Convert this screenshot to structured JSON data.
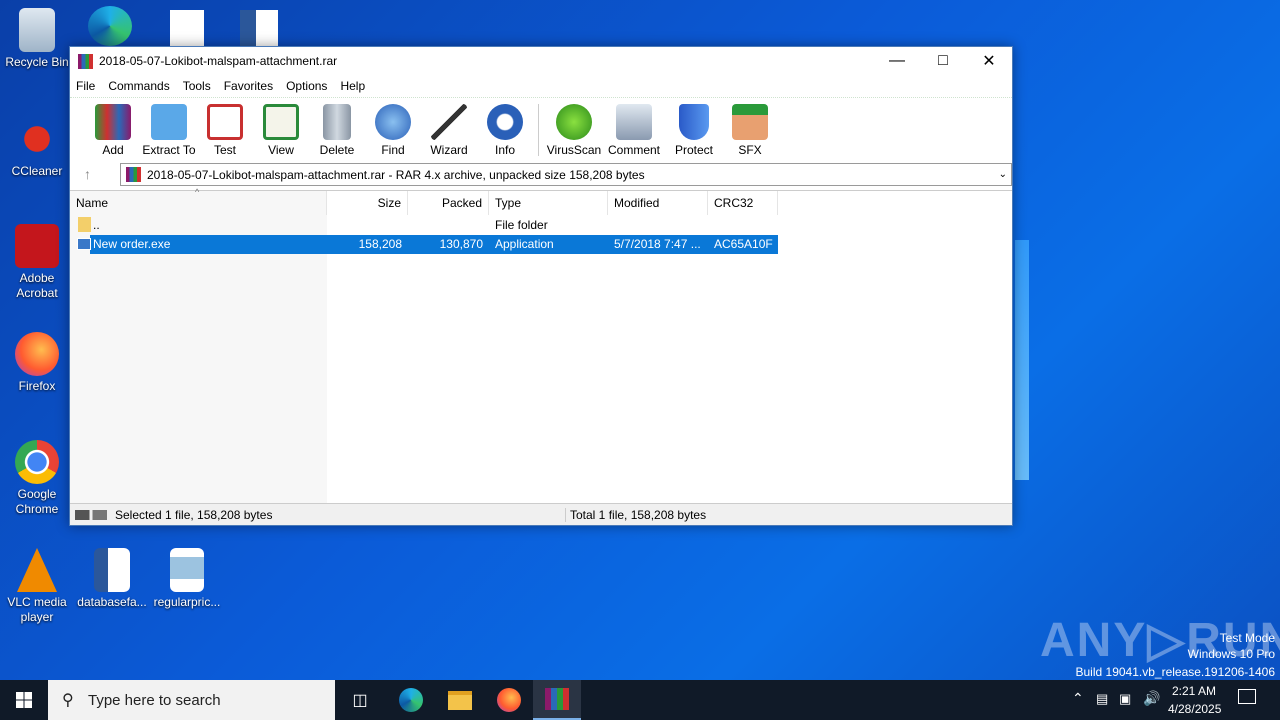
{
  "desktop": {
    "icons": [
      {
        "label": "Recycle Bin",
        "icon": "recycle-bin-icon"
      },
      {
        "label": "CCleaner",
        "icon": "ccleaner-icon"
      },
      {
        "label": "Adobe Acrobat",
        "icon": "acrobat-icon"
      },
      {
        "label": "Firefox",
        "icon": "firefox-icon"
      },
      {
        "label": "Google Chrome",
        "icon": "chrome-icon"
      },
      {
        "label": "VLC media player",
        "icon": "vlc-icon"
      },
      {
        "label": "databasefa...",
        "icon": "word-doc-icon"
      },
      {
        "label": "regularpric...",
        "icon": "image-file-icon"
      }
    ]
  },
  "window": {
    "title": "2018-05-07-Lokibot-malspam-attachment.rar",
    "menu": [
      "File",
      "Commands",
      "Tools",
      "Favorites",
      "Options",
      "Help"
    ],
    "toolbar": [
      "Add",
      "Extract To",
      "Test",
      "View",
      "Delete",
      "Find",
      "Wizard",
      "Info",
      "VirusScan",
      "Comment",
      "Protect",
      "SFX"
    ],
    "address": "2018-05-07-Lokibot-malspam-attachment.rar - RAR 4.x archive, unpacked size 158,208 bytes",
    "columns": [
      "Name",
      "Size",
      "Packed",
      "Type",
      "Modified",
      "CRC32"
    ],
    "rows": [
      {
        "name": "..",
        "size": "",
        "packed": "",
        "type": "File folder",
        "modified": "",
        "crc": ""
      },
      {
        "name": "New order.exe",
        "size": "158,208",
        "packed": "130,870",
        "type": "Application",
        "modified": "5/7/2018 7:47 ...",
        "crc": "AC65A10F"
      }
    ],
    "status_left": "Selected 1 file, 158,208 bytes",
    "status_right": "Total 1 file, 158,208 bytes"
  },
  "taskbar": {
    "search_placeholder": "Type here to search",
    "time": "2:21 AM",
    "date": "4/28/2025"
  },
  "watermark": {
    "logo": "ANY RUN",
    "line1": "Test Mode",
    "line2": "Windows 10 Pro",
    "line3": "Build 19041.vb_release.191206-1406"
  },
  "colors": {
    "selection": "#0a78d7",
    "taskbar": "#101a28"
  }
}
